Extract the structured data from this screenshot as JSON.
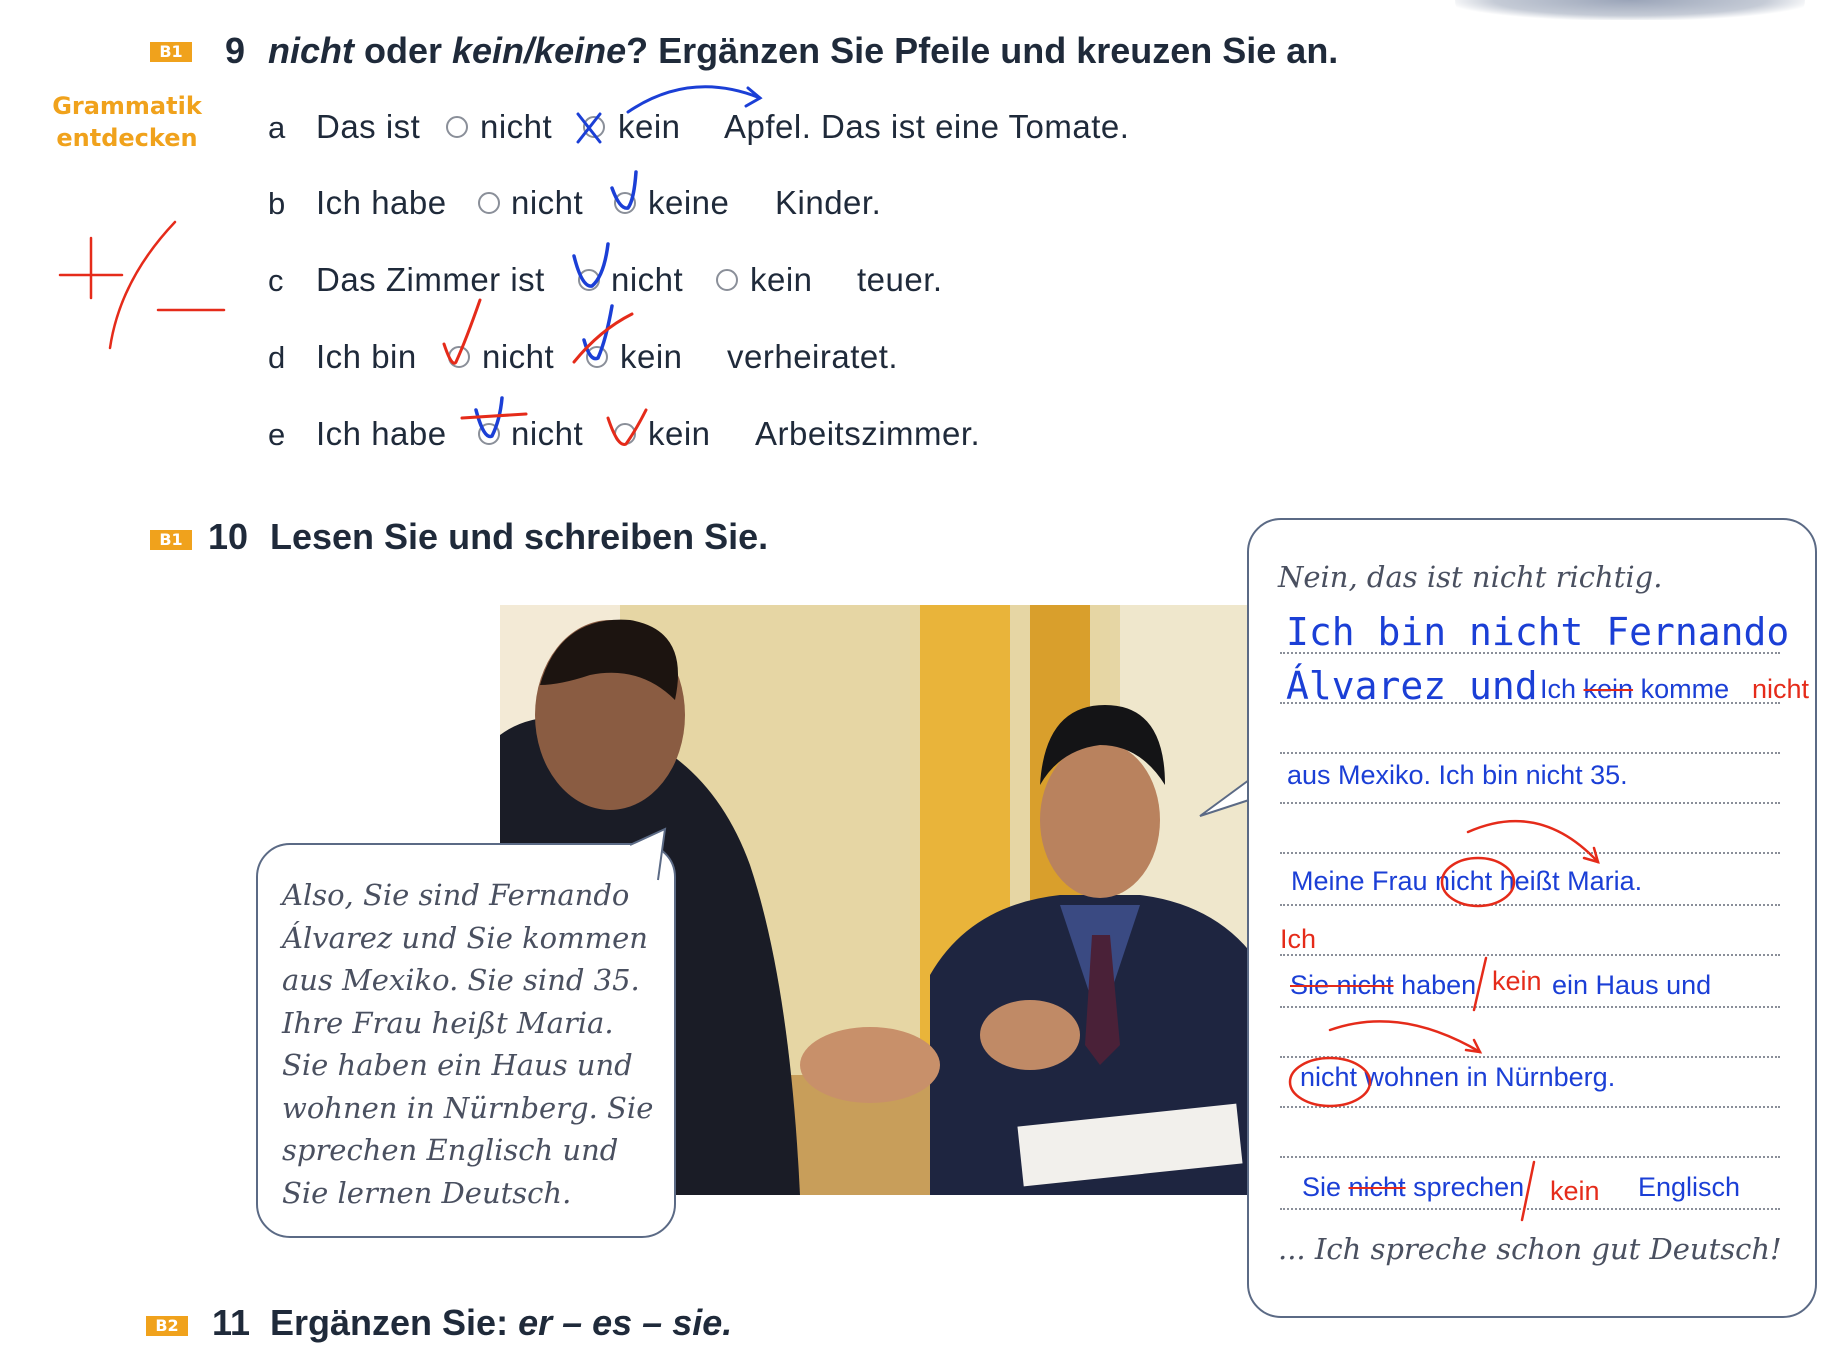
{
  "ex9": {
    "badge": "B1",
    "number": "9",
    "title_italic_1": "nicht",
    "title_part_2": " oder ",
    "title_italic_3": "kein/keine",
    "title_part_4": "? Ergänzen Sie Pfeile und kreuzen Sie an.",
    "sidebar_line1": "Grammatik",
    "sidebar_line2": "entdecken",
    "rows": [
      {
        "letter": "a",
        "stem": "Das ist",
        "opt1": "nicht",
        "opt2": "kein",
        "end": "Apfel. Das ist eine Tomate."
      },
      {
        "letter": "b",
        "stem": "Ich habe",
        "opt1": "nicht",
        "opt2": "keine",
        "end": "Kinder."
      },
      {
        "letter": "c",
        "stem": "Das Zimmer ist",
        "opt1": "nicht",
        "opt2": "kein",
        "end": "teuer."
      },
      {
        "letter": "d",
        "stem": "Ich bin",
        "opt1": "nicht",
        "opt2": "kein",
        "end": "verheiratet."
      },
      {
        "letter": "e",
        "stem": "Ich habe",
        "opt1": "nicht",
        "opt2": "kein",
        "end": "Arbeitszimmer."
      }
    ]
  },
  "ex10": {
    "badge": "B1",
    "number": "10",
    "title": "Lesen Sie und schreiben Sie.",
    "left_bubble": [
      "Also, Sie sind Fernando",
      "Álvarez und Sie kommen",
      "aus Mexiko. Sie sind 35.",
      "Ihre Frau heißt Maria.",
      "Sie haben ein Haus und",
      "wohnen in Nürnberg. Sie",
      "sprechen Englisch und",
      "Sie lernen Deutsch."
    ],
    "right_intro": "Nein, das ist nicht richtig.",
    "right_outro": "... Ich spreche schon gut Deutsch!",
    "hand_line1": "Ich bin nicht Fernando",
    "hand_line2": "Álvarez und",
    "answers": {
      "l2_a": "Ich ",
      "l2_strike": "kein",
      "l2_b": " komme",
      "l2_red": "nicht",
      "l3": "aus Mexiko. Ich bin nicht 35.",
      "l4": "Meine Frau nicht heißt Maria.",
      "l5_red": "Ich",
      "l6_strike": "Sie nicht",
      "l6_a": " haben",
      "l6_red": "kein",
      "l6_b": "ein Haus und",
      "l7": "nicht wohnen in Nürnberg.",
      "l8_a": "Sie ",
      "l8_strike": "nicht",
      "l8_b": " sprechen",
      "l8_red": "kein",
      "l8_c": "Englisch"
    }
  },
  "ex11": {
    "badge": "B2",
    "number": "11",
    "title_part_1": "Ergänzen Sie: ",
    "title_italic_2": "er – es – sie."
  },
  "colors": {
    "accent_orange": "#f0a21c",
    "ink_blue": "#1b3fd6",
    "ink_red": "#e52b1a",
    "text_dark": "#1f2a3a"
  }
}
